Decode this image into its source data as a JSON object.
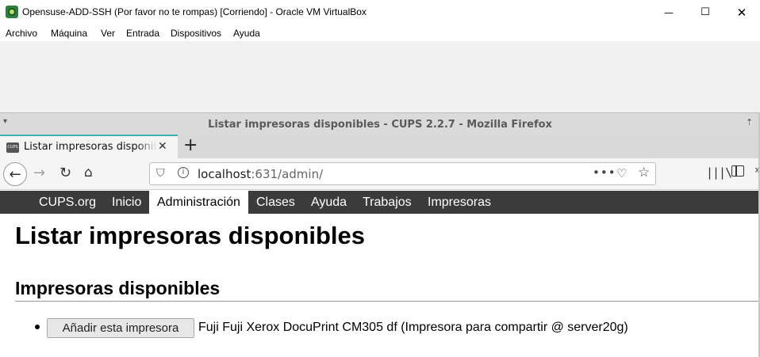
{
  "vbox": {
    "title": "Opensuse-ADD-SSH (Por favor no te rompas) [Corriendo] - Oracle VM VirtualBox",
    "menu": [
      "Archivo",
      "Máquina",
      "Ver",
      "Entrada",
      "Dispositivos",
      "Ayuda"
    ],
    "window_controls": {
      "minimize": "—",
      "maximize": "☐",
      "close": "✕"
    }
  },
  "firefox": {
    "window_title": "Listar impresoras disponibles - CUPS 2.2.7 - Mozilla Firefox",
    "title_menu_glyph": "▾",
    "title_up_glyph": "⇡",
    "tab": {
      "favicon_text": "CUPS",
      "title": "Listar impresoras disponibles",
      "close": "✕"
    },
    "new_tab": "+",
    "nav": {
      "back": "←",
      "forward": "→",
      "reload": "↻",
      "home": "⌂"
    },
    "url": {
      "host": "localhost",
      "path": ":631/admin/"
    },
    "icons": {
      "page_actions": "•••",
      "pocket": "♡",
      "bookmark": "☆",
      "library": "|||\\",
      "overflow": "»"
    }
  },
  "cups_nav": {
    "items": [
      "CUPS.org",
      "Inicio",
      "Administración",
      "Clases",
      "Ayuda",
      "Trabajos",
      "Impresoras"
    ],
    "active": "Administración"
  },
  "content": {
    "page_title": "Listar impresoras disponibles",
    "section_title": "Impresoras disponibles",
    "printers": [
      {
        "button_label": "Añadir esta impresora",
        "description": "Fuji Fuji Xerox DocuPrint CM305 df (Impresora para compartir @ server20g)"
      }
    ]
  }
}
